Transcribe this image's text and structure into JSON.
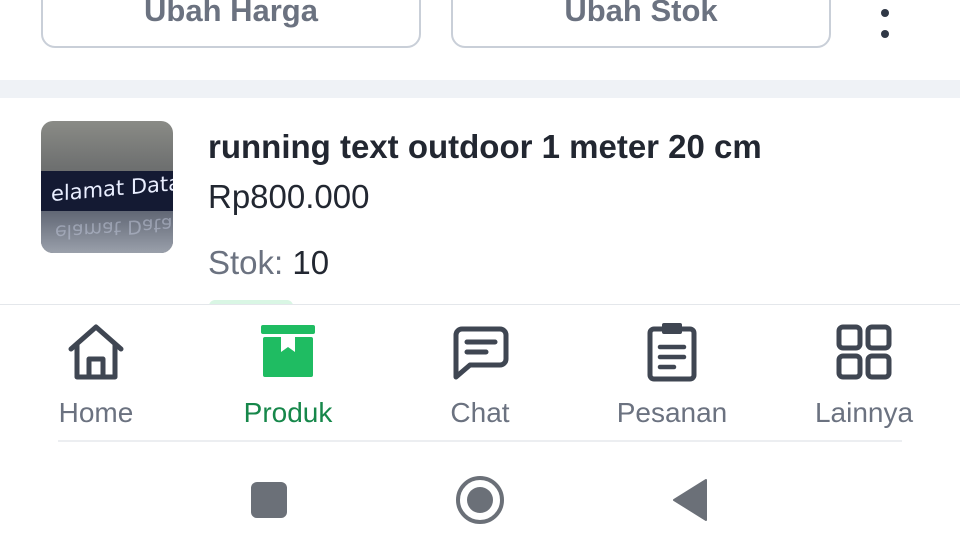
{
  "toolbar": {
    "edit_price_label": "Ubah Harga",
    "edit_stock_label": "Ubah Stok",
    "more_icon": "more-vertical-icon"
  },
  "product": {
    "name": "running text outdoor 1 meter 20 cm",
    "price": "Rp800.000",
    "stock_label": "Stok:",
    "stock_value": "10",
    "image_text": "elamat Data"
  },
  "bottom_nav": {
    "items": [
      {
        "label": "Home",
        "icon": "home-icon",
        "active": false
      },
      {
        "label": "Produk",
        "icon": "box-icon",
        "active": true
      },
      {
        "label": "Chat",
        "icon": "chat-icon",
        "active": false
      },
      {
        "label": "Pesanan",
        "icon": "clipboard-icon",
        "active": false
      },
      {
        "label": "Lainnya",
        "icon": "grid-icon",
        "active": false
      }
    ]
  },
  "system_nav": {
    "recents_icon": "recents-square-icon",
    "home_icon": "home-circle-icon",
    "back_icon": "back-triangle-icon"
  },
  "colors": {
    "accent": "#16874a",
    "accent_icon": "#1fbc62",
    "text_primary": "#222731",
    "text_muted": "#6b7280",
    "icon_dark": "#3f4652"
  }
}
